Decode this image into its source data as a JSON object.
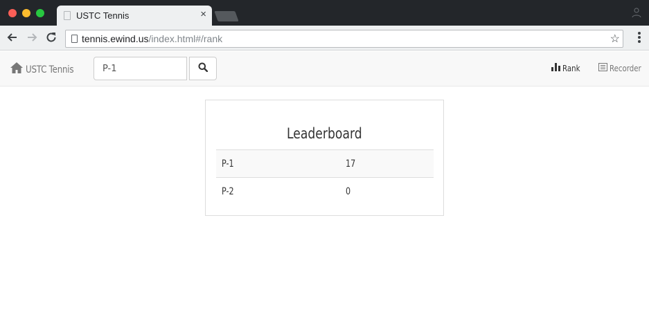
{
  "browser": {
    "tab_title": "USTC Tennis",
    "tab_close": "×",
    "url_host": "tennis.ewind.us",
    "url_path": "/index.html#/rank",
    "star": "☆"
  },
  "navbar": {
    "brand": "USTC Tennis",
    "search": {
      "value": "P-1"
    },
    "links": {
      "rank": "Rank",
      "recorder": "Recorder"
    }
  },
  "leaderboard": {
    "title": "Leaderboard",
    "rows": [
      {
        "name": "P-1",
        "score": "17"
      },
      {
        "name": "P-2",
        "score": "0"
      }
    ]
  },
  "colors": {
    "chrome_dark": "#23262a",
    "toolbar": "#eef0f1",
    "navbar_bg": "#f8f8f8",
    "traffic_red": "#fc5f57",
    "traffic_yellow": "#fdbc2e",
    "traffic_green": "#28c840"
  }
}
